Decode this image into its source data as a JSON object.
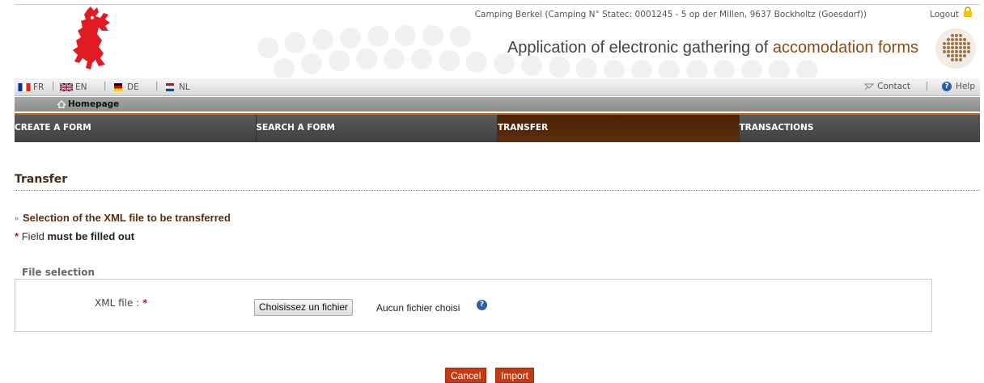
{
  "header": {
    "user_info": "Camping Berkel (Camping N° Statec: 0001245 - 5 op der Millen, 9637 Bockholtz (Goesdorf))",
    "logout_label": "Logout",
    "app_title_main": "Application of electronic gathering of ",
    "app_title_accent": "accomodation forms"
  },
  "languages": [
    {
      "code": "FR",
      "icon": "flag-fr-icon"
    },
    {
      "code": "EN",
      "icon": "flag-uk-icon"
    },
    {
      "code": "DE",
      "icon": "flag-de-icon"
    },
    {
      "code": "NL",
      "icon": "flag-nl-icon"
    }
  ],
  "utility": {
    "contact_label": "Contact",
    "help_label": "Help"
  },
  "breadcrumb": {
    "home_label": "Homepage"
  },
  "nav": {
    "items": [
      {
        "label": "CREATE A FORM"
      },
      {
        "label": "SEARCH A FORM"
      },
      {
        "label": "TRANSFER"
      },
      {
        "label": "TRANSACTIONS"
      }
    ],
    "active": "TRANSFER"
  },
  "content": {
    "page_title": "Transfer",
    "section_heading": "Selection of the XML file to be transferred",
    "required_star": "*",
    "required_text_plain": "Field ",
    "required_text_bold": "must be filled out",
    "fieldset_legend": "File selection",
    "field_label": "XML file : ",
    "file_button_label": "Choisissez un fichier",
    "file_status": "Aucun fichier choisi"
  },
  "buttons": {
    "cancel_label": "Cancel",
    "import_label": "Import"
  },
  "colors": {
    "accent": "#8a4a12",
    "nav_active": "#4a2308",
    "button": "#c43a13",
    "required": "#b01c1c"
  }
}
